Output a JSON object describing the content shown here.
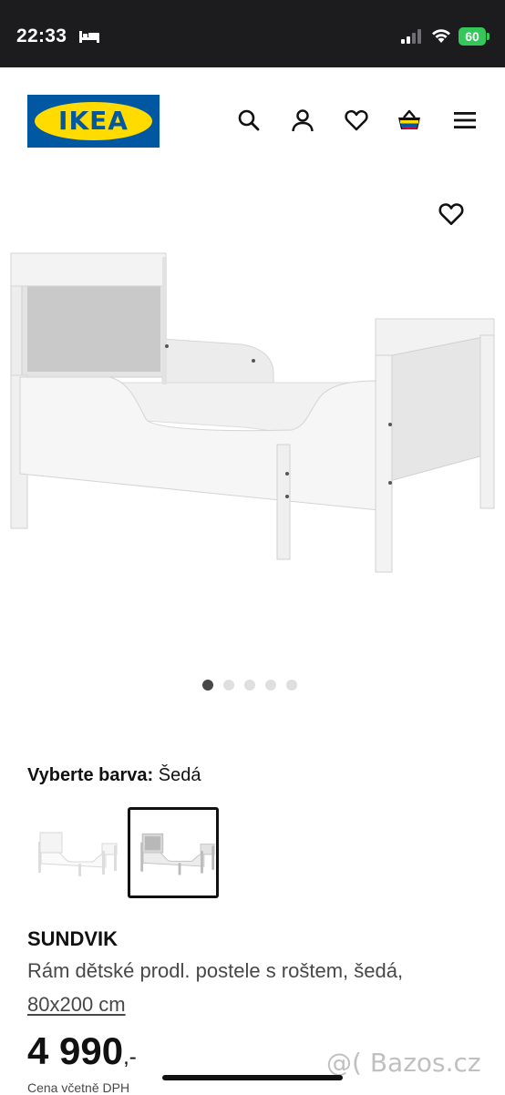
{
  "status_bar": {
    "time": "22:33",
    "battery": "60"
  },
  "header": {
    "logo_text": "IKEA",
    "icons": [
      "search-icon",
      "account-icon",
      "heart-icon",
      "cart-icon",
      "menu-icon"
    ]
  },
  "gallery": {
    "image_count": 5,
    "active_index": 0
  },
  "color_select": {
    "label": "Vyberte barva:",
    "value": "Šedá",
    "options": [
      "white",
      "grey"
    ],
    "selected_index": 1
  },
  "product": {
    "name": "SUNDVIK",
    "description": "Rám dětské prodl. postele s roštem, šedá,",
    "size": "80x200 cm",
    "price": "4 990",
    "price_suffix": ",-",
    "price_note": "Cena včetně DPH"
  },
  "watermark": "@( Bazos.cz",
  "colors": {
    "brand_blue": "#0058a3",
    "brand_yellow": "#ffdb00",
    "battery_green": "#34c759"
  }
}
